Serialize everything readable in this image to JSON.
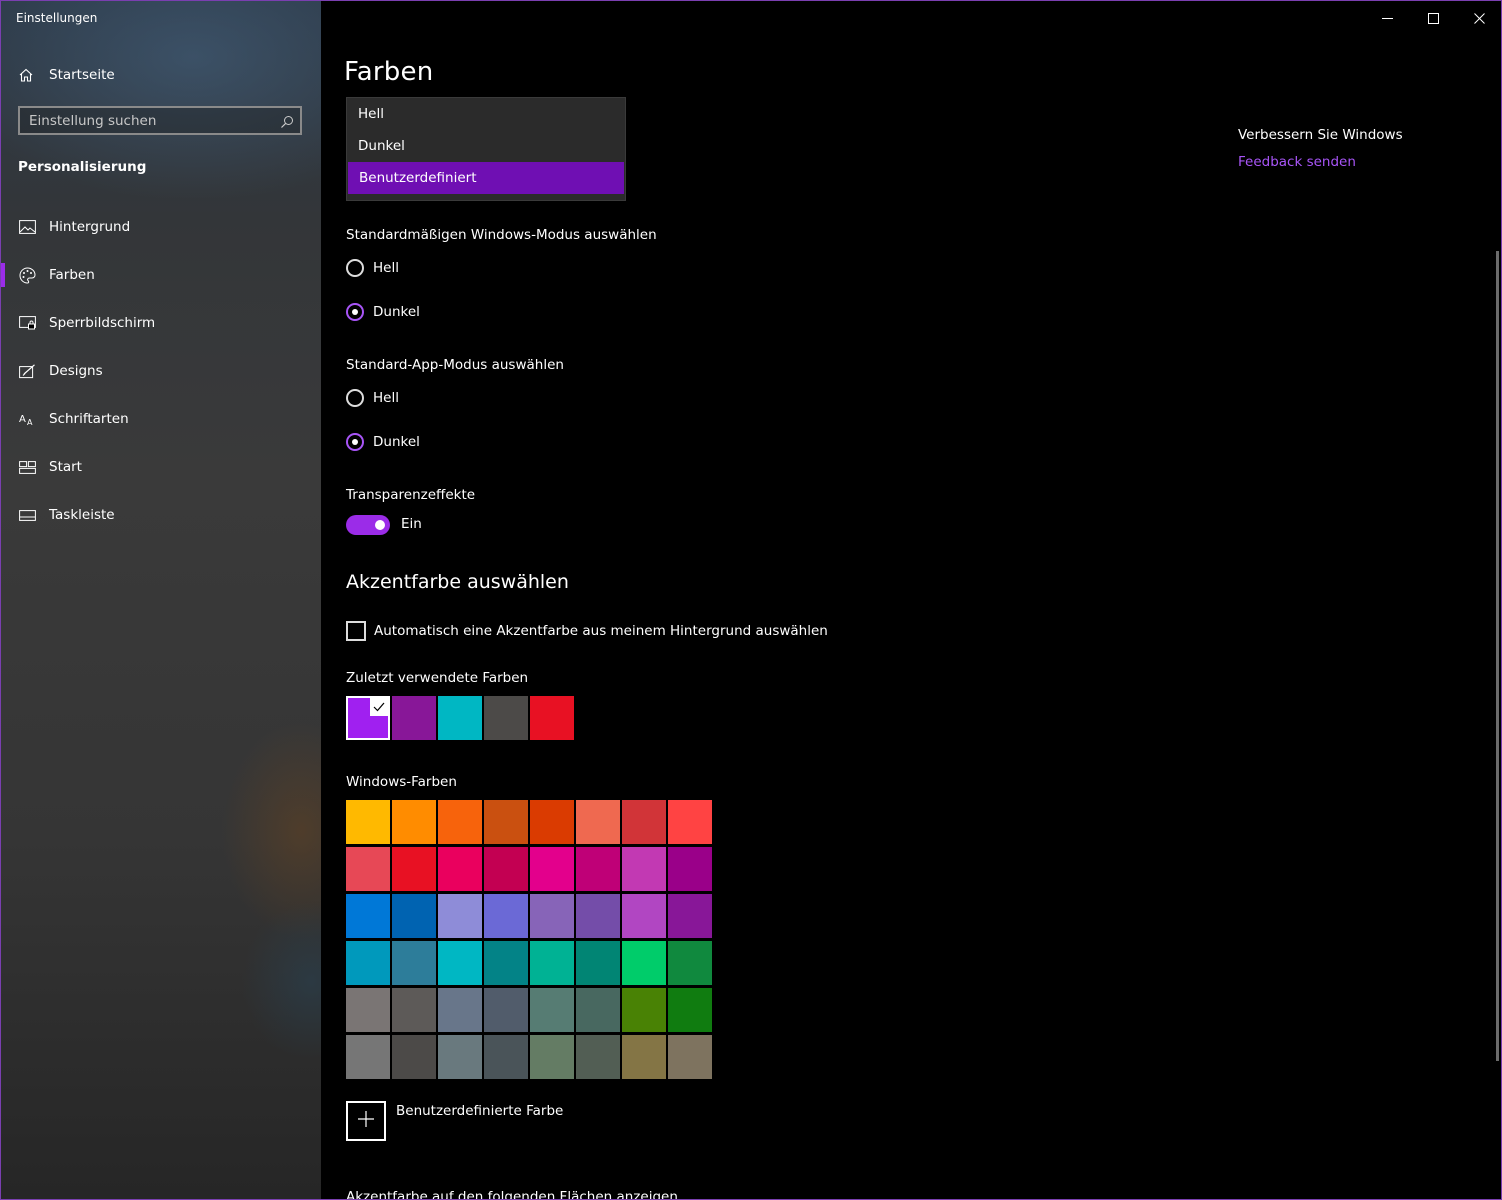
{
  "window": {
    "title": "Einstellungen"
  },
  "sidebar": {
    "home_label": "Startseite",
    "search_placeholder": "Einstellung suchen",
    "section": "Personalisierung",
    "items": [
      {
        "label": "Hintergrund",
        "icon": "picture-icon"
      },
      {
        "label": "Farben",
        "icon": "palette-icon",
        "active": true
      },
      {
        "label": "Sperrbildschirm",
        "icon": "lock-screen-icon"
      },
      {
        "label": "Designs",
        "icon": "themes-icon"
      },
      {
        "label": "Schriftarten",
        "icon": "fonts-icon"
      },
      {
        "label": "Start",
        "icon": "start-icon"
      },
      {
        "label": "Taskleiste",
        "icon": "taskbar-icon"
      }
    ]
  },
  "main": {
    "title": "Farben",
    "color_dropdown": {
      "options": [
        "Hell",
        "Dunkel",
        "Benutzerdefiniert"
      ],
      "selected": "Benutzerdefiniert"
    },
    "windows_mode": {
      "label": "Standardmäßigen Windows-Modus auswählen",
      "options": [
        "Hell",
        "Dunkel"
      ],
      "selected": "Dunkel"
    },
    "app_mode": {
      "label": "Standard-App-Modus auswählen",
      "options": [
        "Hell",
        "Dunkel"
      ],
      "selected": "Dunkel"
    },
    "transparency": {
      "label": "Transparenzeffekte",
      "state": "Ein"
    },
    "accent": {
      "heading": "Akzentfarbe auswählen",
      "auto_checkbox": "Automatisch eine Akzentfarbe aus meinem Hintergrund auswählen",
      "recent_label": "Zuletzt verwendete Farben",
      "recent_colors": [
        "#a020f0",
        "#881798",
        "#00b7c3",
        "#4c4a48",
        "#e81123"
      ],
      "windows_label": "Windows-Farben",
      "windows_colors": [
        "#ffb900",
        "#ff8c00",
        "#f7630c",
        "#ca5010",
        "#da3b01",
        "#ef6950",
        "#d13438",
        "#ff4343",
        "#e74856",
        "#e81123",
        "#ea005e",
        "#c30052",
        "#e3008c",
        "#bf0077",
        "#c239b3",
        "#9a0089",
        "#0078d7",
        "#0063b1",
        "#8e8cd8",
        "#6b69d6",
        "#8764b8",
        "#744da9",
        "#b146c2",
        "#881798",
        "#0099bc",
        "#2d7d9a",
        "#00b7c3",
        "#038387",
        "#00b294",
        "#018574",
        "#00cc6a",
        "#10893e",
        "#7a7574",
        "#5d5a58",
        "#68768a",
        "#515c6b",
        "#567c73",
        "#486860",
        "#498205",
        "#107c10",
        "#767676",
        "#4c4a48",
        "#69797e",
        "#4a5459",
        "#647c64",
        "#525e54",
        "#847545",
        "#7e735f"
      ],
      "custom_label": "Benutzerdefinierte Farbe",
      "surfaces_label": "Akzentfarbe auf den folgenden Flächen anzeigen"
    },
    "right_panel": {
      "title": "Verbessern Sie Windows",
      "link": "Feedback senden"
    },
    "accent_color": "#9b2ce8"
  }
}
